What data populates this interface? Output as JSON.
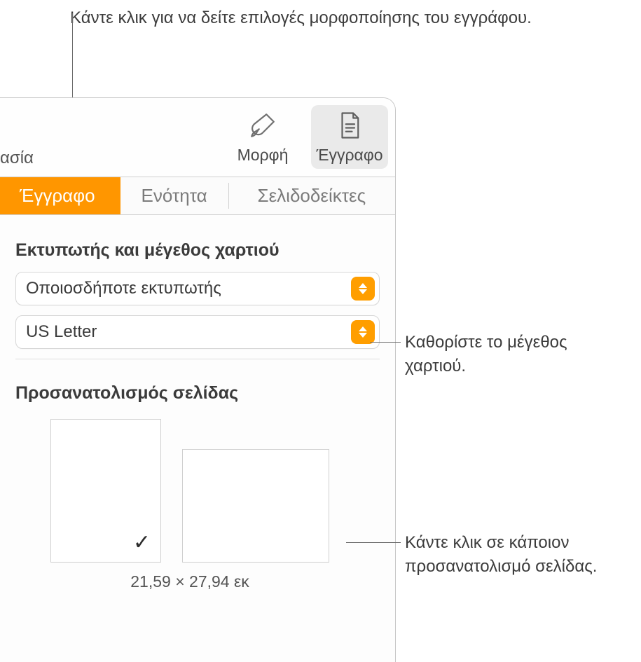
{
  "callouts": {
    "top": "Κάντε κλικ για να δείτε επιλογές μορφοποίησης του εγγράφου.",
    "paper_size": "Καθορίστε το μέγεθος χαρτιού.",
    "orientation": "Κάντε κλικ σε κάποιον προσανατολισμό σελίδας."
  },
  "toolbar": {
    "left_truncated": "ασία",
    "format_label": "Μορφή",
    "document_label": "Έγγραφο"
  },
  "tabs": {
    "document": "Έγγραφο",
    "section": "Ενότητα",
    "bookmarks": "Σελιδοδείκτες"
  },
  "printer_section": {
    "title": "Εκτυπωτής και μέγεθος χαρτιού",
    "printer_value": "Οποιοσδήποτε εκτυπωτής",
    "paper_value": "US Letter"
  },
  "orientation_section": {
    "title": "Προσανατολισμός σελίδας",
    "dimensions": "21,59 × 27,94 εκ"
  }
}
